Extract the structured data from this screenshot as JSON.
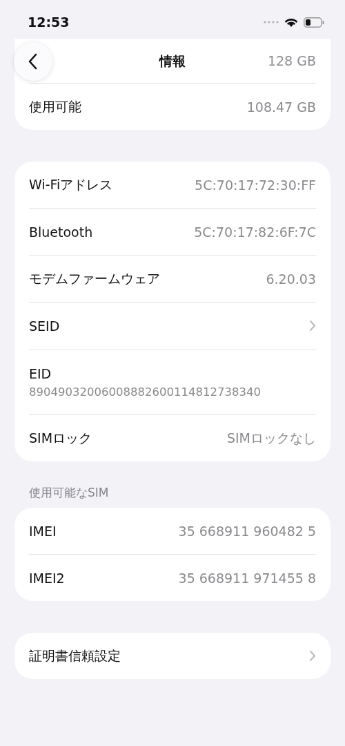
{
  "status_bar": {
    "time": "12:53"
  },
  "nav": {
    "title": "情報"
  },
  "sections": [
    {
      "rows": [
        {
          "kind": "obscured",
          "value": "128 GB"
        },
        {
          "kind": "value",
          "label": "使用可能",
          "value": "108.47 GB"
        }
      ]
    },
    {
      "rows": [
        {
          "kind": "value",
          "label": "Wi-Fiアドレス",
          "value": "5C:70:17:72:30:FF"
        },
        {
          "kind": "value",
          "label": "Bluetooth",
          "value": "5C:70:17:82:6F:7C"
        },
        {
          "kind": "value",
          "label": "モデムファームウェア",
          "value": "6.20.03"
        },
        {
          "kind": "link",
          "label": "SEID"
        },
        {
          "kind": "stacked",
          "label": "EID",
          "value": "89049032006008882600114812738340"
        },
        {
          "kind": "value",
          "label": "SIMロック",
          "value": "SIMロックなし"
        }
      ]
    },
    {
      "header": "使用可能なSIM",
      "rows": [
        {
          "kind": "value",
          "label": "IMEI",
          "value": "35 668911 960482 5"
        },
        {
          "kind": "value",
          "label": "IMEI2",
          "value": "35 668911 971455 8"
        }
      ]
    },
    {
      "rows": [
        {
          "kind": "link",
          "label": "証明書信頼設定"
        }
      ]
    }
  ]
}
